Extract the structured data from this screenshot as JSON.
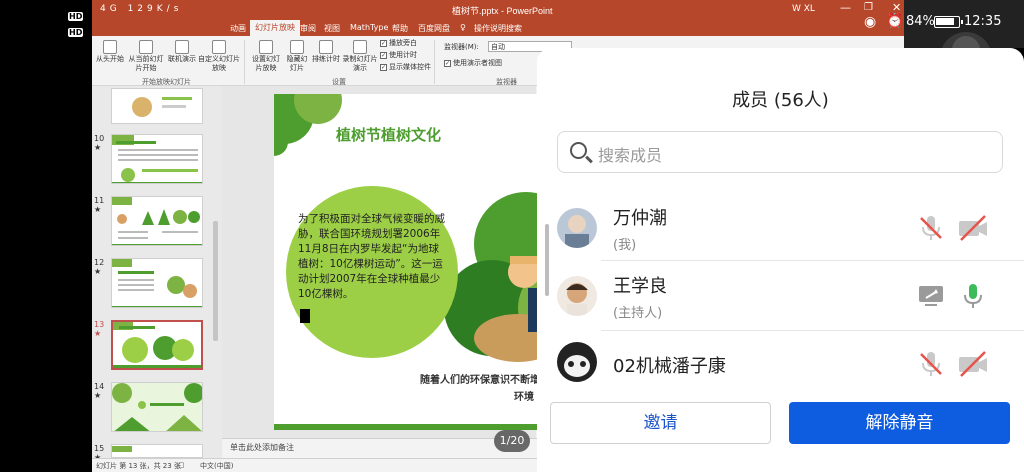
{
  "status_left": {
    "hd1": "HD",
    "hd2": "HD",
    "net": "4G",
    "speed_value": "129",
    "speed_unit": "K/s"
  },
  "status_right": {
    "carrier": "W XL",
    "battery_pct": "84%",
    "time": "12:35"
  },
  "ppt": {
    "title": "植树节.pptx - PowerPoint",
    "tabs": [
      "动画",
      "幻灯片放映",
      "审阅",
      "视图",
      "MathType",
      "帮助",
      "百度网盘",
      "操作说明搜索"
    ],
    "active_tab": "幻灯片放映",
    "ribbon": {
      "from_start": "从头开始",
      "from_current": "从当前幻灯片开始",
      "online": "联机演示",
      "custom": "自定义幻灯片放映",
      "group_start": "开始放映幻灯片",
      "setup": "设置幻灯片放映",
      "hide": "隐藏幻灯片",
      "rehearse": "排练计时",
      "record": "录制幻灯片演示",
      "chk_narration": "播放旁白",
      "chk_timing": "使用计时",
      "chk_media": "显示媒体控件",
      "group_setup": "设置",
      "monitor_label": "监视器(M):",
      "monitor_value": "自动",
      "presenter_view": "使用演示者视图",
      "group_monitor": "监视器"
    },
    "slide_numbers": [
      "10",
      "11",
      "12",
      "13",
      "14",
      "15"
    ],
    "star": "★",
    "slide": {
      "title": "植树节植树文化",
      "body": "为了积极面对全球气候变暖的威胁，联合国环境规划署2006年11月8日在内罗毕发起“为地球植树：10亿棵树运动”。这一运动计划2007年在全球种植最少10亿棵树。",
      "bottom_line1": "随着人们的环保意识不断增",
      "bottom_line2": "环境"
    },
    "notes_placeholder": "单击此处添加备注",
    "status_slide": "幻灯片 第 13 张，共 23 张",
    "status_lang": "中文(中国)",
    "page_indicator": "1/20"
  },
  "panel": {
    "title": "成员 (56人)",
    "search_placeholder": "搜索成员",
    "members": [
      {
        "name": "万仲潮",
        "role": "(我)"
      },
      {
        "name": "王学良",
        "role": "(主持人)"
      },
      {
        "name": "02机械潘子康",
        "role": ""
      }
    ],
    "invite_label": "邀请",
    "unmute_label": "解除静音"
  },
  "colors": {
    "ppt_red": "#b7472a",
    "slide_green": "#4e9e2f",
    "circle_green": "#9ccf46",
    "accent_blue": "#0e5de0",
    "mute_red": "#e5534b",
    "mic_green": "#3dbb5b"
  }
}
